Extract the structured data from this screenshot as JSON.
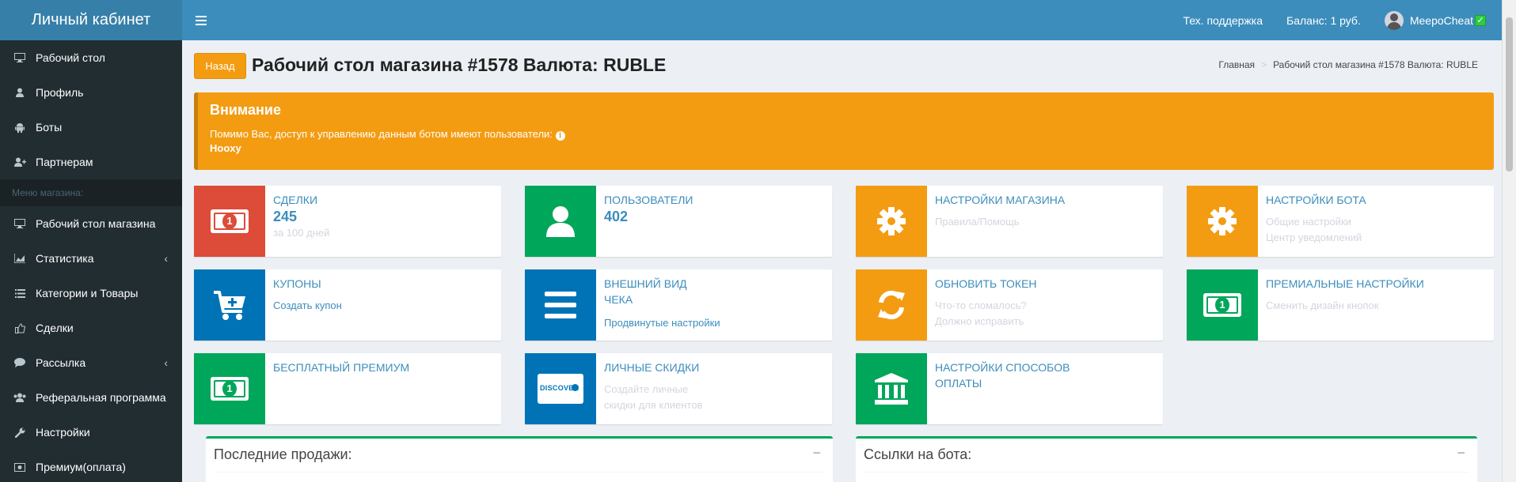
{
  "header": {
    "logo": "Личный кабинет",
    "support": "Тех. поддержка",
    "balance": "Баланс: 1 руб.",
    "username": "MeepoCheat",
    "verified_mark": "✓"
  },
  "sidebar": {
    "items_top": [
      {
        "label": "Рабочий стол",
        "icon": "desktop-icon"
      },
      {
        "label": "Профиль",
        "icon": "user-icon"
      },
      {
        "label": "Боты",
        "icon": "android-icon"
      },
      {
        "label": "Партнерам",
        "icon": "user-plus-icon"
      }
    ],
    "section_header": "Меню магазина:",
    "items_shop": [
      {
        "label": "Рабочий стол магазина",
        "icon": "desktop-icon"
      },
      {
        "label": "Статистика",
        "icon": "chart-icon",
        "caret": "‹"
      },
      {
        "label": "Категории и Товары",
        "icon": "list-icon"
      },
      {
        "label": "Сделки",
        "icon": "thumbs-up-icon"
      },
      {
        "label": "Рассылка",
        "icon": "comment-icon",
        "caret": "‹"
      },
      {
        "label": "Реферальная программа",
        "icon": "users-icon"
      },
      {
        "label": "Настройки",
        "icon": "wrench-icon"
      },
      {
        "label": "Премиум(оплата)",
        "icon": "money-icon"
      }
    ]
  },
  "page": {
    "back": "Назад",
    "title": "Рабочий стол магазина #1578 Валюта: RUBLE",
    "breadcrumb_home": "Главная",
    "breadcrumb_sep": ">",
    "breadcrumb_current": "Рабочий стол магазина #1578 Валюта: RUBLE"
  },
  "alert": {
    "title": "Внимание",
    "text": "Помимо Вас, доступ к управлению данным ботом имеют пользователи:",
    "info": "i",
    "user": "Hooxy"
  },
  "boxes": {
    "deals": {
      "label": "Сделки",
      "value": "245",
      "sub": "за 100 дней",
      "coin": "1"
    },
    "users": {
      "label": "Пользователи",
      "value": "402"
    },
    "shop_settings": {
      "label": "Настройки магазина",
      "sub": "Правила/Помощь"
    },
    "bot_settings": {
      "label": "Настройки бота",
      "sub1": "Общие настройки",
      "sub2": "Центр уведомлений"
    },
    "coupons": {
      "label": "Купоны",
      "link": "Создать купон"
    },
    "receipt": {
      "label1": "Внешний вид",
      "label2": "чека",
      "link": "Продвинутые настройки"
    },
    "token": {
      "label": "Обновить токен",
      "sub1": "Что-то сломалось?",
      "sub2": "Должно исправить"
    },
    "premium_settings": {
      "label": "Премиальные настройки",
      "sub": "Сменить дизайн кнопок",
      "coin": "1"
    },
    "free_premium": {
      "label": "Бесплатный премиум",
      "coin": "1"
    },
    "discounts": {
      "label": "Личные скидки",
      "sub1": "Создайте личные",
      "sub2": "скидки для клиентов",
      "card_text": "DISCOVER"
    },
    "payment": {
      "label1": "Настройки способов",
      "label2": "оплаты"
    }
  },
  "panels": {
    "recent_sales": "Последние продажи:",
    "bot_links": "Ссылки на бота:",
    "collapse": "−"
  }
}
